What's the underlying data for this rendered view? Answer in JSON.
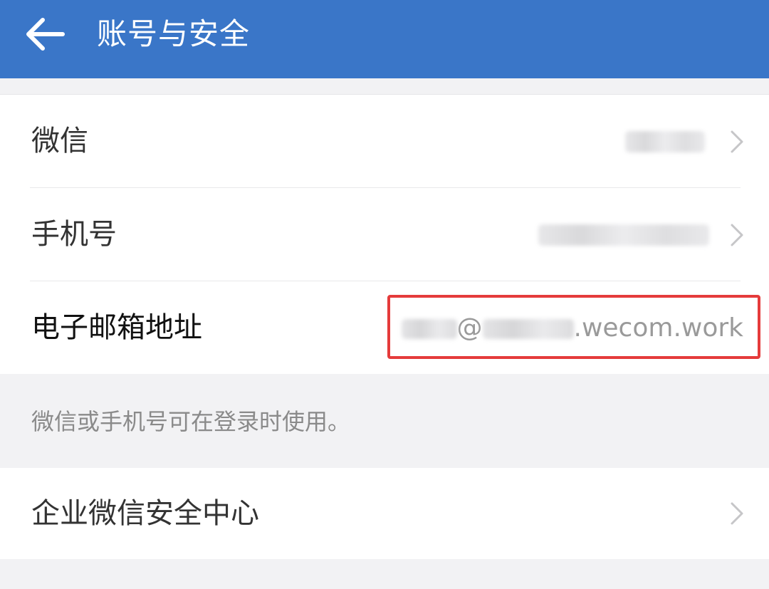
{
  "header": {
    "title": "账号与安全",
    "back_icon": "back-arrow-icon",
    "color": "#3a76c8"
  },
  "account_list": {
    "items": [
      {
        "label": "微信"
      },
      {
        "label": "手机号"
      },
      {
        "label": "电子邮箱地址",
        "value_suffix": ".wecom.work",
        "value_at": "@"
      }
    ]
  },
  "hint": {
    "text": "微信或手机号可在登录时使用。"
  },
  "security_center": {
    "label": "企业微信安全中心"
  },
  "colors": {
    "highlight": "#e53b3b",
    "background": "#f2f2f4"
  }
}
